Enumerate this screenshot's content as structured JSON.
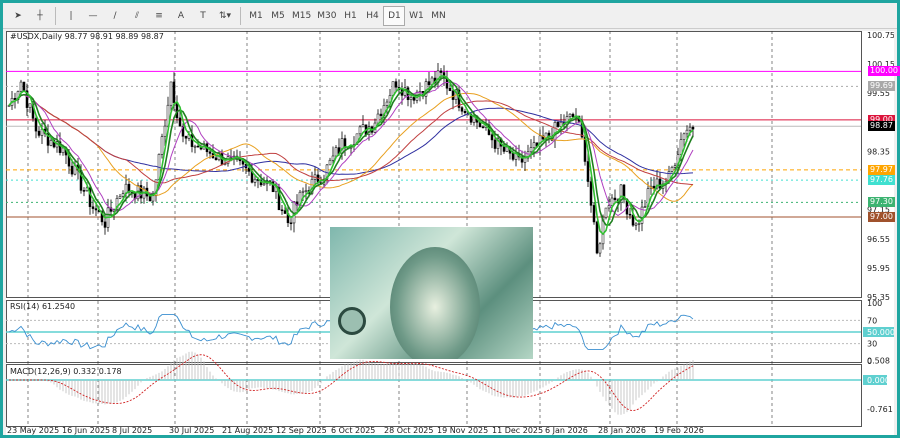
{
  "toolbar": {
    "tools": [
      {
        "name": "cursor-icon",
        "glyph": "➤"
      },
      {
        "name": "crosshair-icon",
        "glyph": "┼"
      },
      {
        "name": "vertical-line-icon",
        "glyph": "|"
      },
      {
        "name": "horizontal-line-icon",
        "glyph": "—"
      },
      {
        "name": "trendline-icon",
        "glyph": "/"
      },
      {
        "name": "equidistant-channel-icon",
        "glyph": "⫽"
      },
      {
        "name": "fibonacci-icon",
        "glyph": "≡"
      },
      {
        "name": "text-icon",
        "glyph": "A"
      },
      {
        "name": "text-label-icon",
        "glyph": "T"
      },
      {
        "name": "arrows-dropdown-icon",
        "glyph": "⇅▾"
      }
    ],
    "timeframes": [
      "M1",
      "M5",
      "M15",
      "M30",
      "H1",
      "H4",
      "D1",
      "W1",
      "MN"
    ],
    "active_timeframe": "D1"
  },
  "chart": {
    "symbol_line": "#USDX,Daily  98.77 98.91 98.89 98.87",
    "price_axis": [
      "100.75",
      "100.15",
      "99.55",
      "98.35",
      "97.15",
      "96.55",
      "95.95",
      "95.35"
    ],
    "levels": [
      {
        "price": 100.0,
        "label": "100.00",
        "color": "#ff00ff",
        "style": "solid"
      },
      {
        "price": 99.69,
        "label": "99.69",
        "color": "#a9a9a9",
        "style": "dotted"
      },
      {
        "price": 99.0,
        "label": "99.00",
        "color": "#dc143c",
        "style": "solid"
      },
      {
        "price": 98.87,
        "label": "98.87",
        "color": "#000000",
        "style": "solid"
      },
      {
        "price": 97.97,
        "label": "97.97",
        "color": "#ffa500",
        "style": "dashed"
      },
      {
        "price": 97.76,
        "label": "97.76",
        "color": "#40e0d0",
        "style": "dotted"
      },
      {
        "price": 97.3,
        "label": "97.30",
        "color": "#3cb371",
        "style": "dotted"
      },
      {
        "price": 97.0,
        "label": "97.00",
        "color": "#a0522d",
        "style": "solid"
      }
    ],
    "date_axis": [
      "23 May 2025",
      "16 Jun 2025",
      "8 Jul 2025",
      "30 Jul 2025",
      "21 Aug 2025",
      "12 Sep 2025",
      "6 Oct 2025",
      "28 Oct 2025",
      "19 Nov 2025",
      "11 Dec 2025",
      "6 Jan 2026",
      "28 Jan 2026",
      "19 Feb 2026"
    ]
  },
  "rsi": {
    "label": "RSI(14) 61.2540",
    "axis": [
      "100",
      "70",
      "30",
      "0"
    ],
    "level_label": "50.0000"
  },
  "macd": {
    "label": "MACD(12,26,9) 0.332 0.178",
    "axis": [
      "0.508",
      "-0.761"
    ],
    "zero_label": "0.000"
  },
  "chart_data": {
    "type": "candlestick",
    "approx_close_path": [
      [
        0,
        99.3
      ],
      [
        4,
        99.8
      ],
      [
        9,
        98.8
      ],
      [
        18,
        98.4
      ],
      [
        28,
        97.2
      ],
      [
        32,
        96.9
      ],
      [
        38,
        97.6
      ],
      [
        48,
        97.4
      ],
      [
        54,
        99.8
      ],
      [
        58,
        98.6
      ],
      [
        68,
        98.3
      ],
      [
        78,
        98.0
      ],
      [
        88,
        97.6
      ],
      [
        93,
        96.9
      ],
      [
        98,
        97.5
      ],
      [
        105,
        97.9
      ],
      [
        111,
        98.5
      ],
      [
        121,
        98.9
      ],
      [
        129,
        99.8
      ],
      [
        134,
        99.5
      ],
      [
        144,
        99.9
      ],
      [
        150,
        99.4
      ],
      [
        157,
        98.9
      ],
      [
        164,
        98.4
      ],
      [
        170,
        98.1
      ],
      [
        177,
        98.5
      ],
      [
        184,
        98.9
      ],
      [
        189,
        99.1
      ],
      [
        192,
        98.3
      ],
      [
        196,
        96.2
      ],
      [
        199,
        97.3
      ],
      [
        204,
        97.5
      ],
      [
        209,
        96.8
      ],
      [
        214,
        97.6
      ],
      [
        220,
        97.8
      ],
      [
        225,
        98.8
      ],
      [
        228,
        98.87
      ]
    ]
  }
}
